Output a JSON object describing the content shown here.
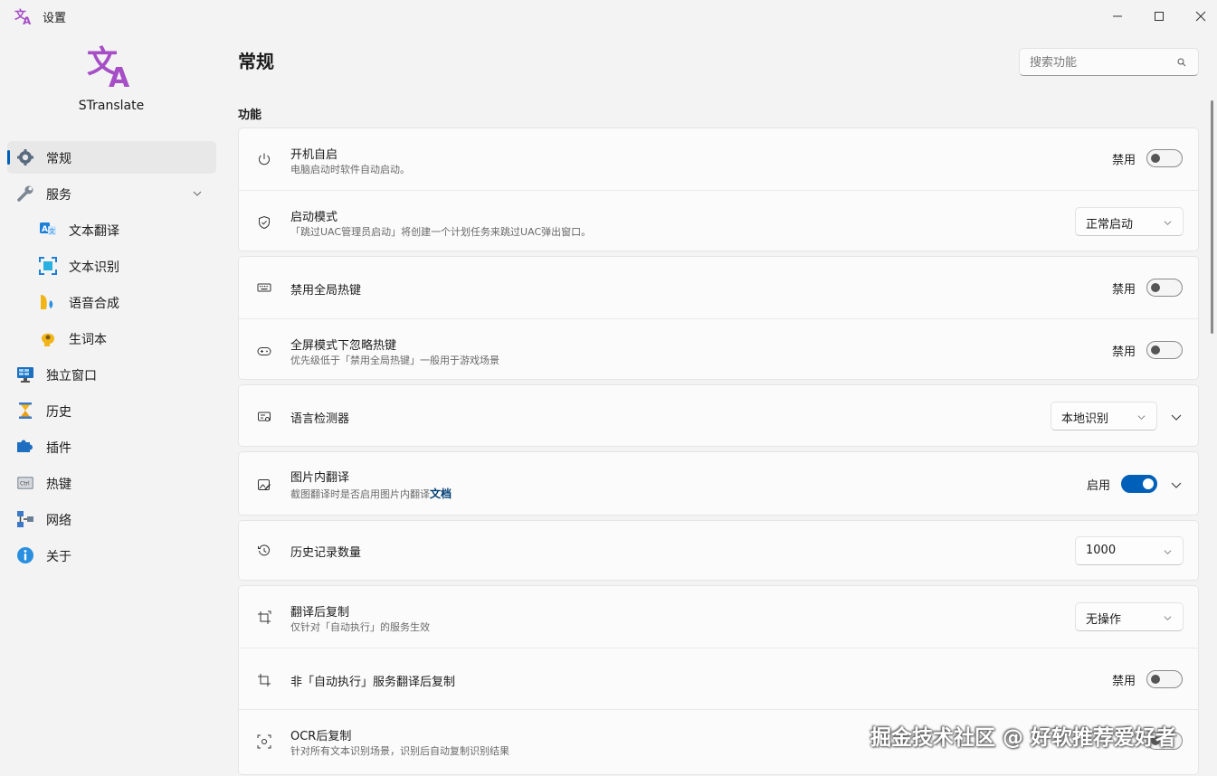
{
  "window": {
    "title": "设置"
  },
  "brand": {
    "name": "STranslate"
  },
  "sidebar": {
    "items": [
      {
        "label": "常规",
        "icon": "gear-icon"
      },
      {
        "label": "服务",
        "icon": "wrench-icon"
      },
      {
        "label": "文本翻译",
        "icon": "translate-icon"
      },
      {
        "label": "文本识别",
        "icon": "ocr-icon"
      },
      {
        "label": "语音合成",
        "icon": "speech-icon"
      },
      {
        "label": "生词本",
        "icon": "notebook-icon"
      },
      {
        "label": "独立窗口",
        "icon": "monitor-icon"
      },
      {
        "label": "历史",
        "icon": "hourglass-icon"
      },
      {
        "label": "插件",
        "icon": "plugin-icon"
      },
      {
        "label": "热键",
        "icon": "keyboard-ctrl-icon"
      },
      {
        "label": "网络",
        "icon": "network-icon"
      },
      {
        "label": "关于",
        "icon": "info-icon"
      }
    ]
  },
  "main": {
    "title": "常规",
    "search": {
      "placeholder": "搜索功能"
    },
    "section": "功能",
    "rows": {
      "autostart": {
        "title": "开机自启",
        "desc": "电脑启动时软件自动启动。",
        "state": "禁用"
      },
      "startmode": {
        "title": "启动模式",
        "desc": "「跳过UAC管理员启动」将创建一个计划任务来跳过UAC弹出窗口。",
        "value": "正常启动"
      },
      "disable_hotkeys": {
        "title": "禁用全局热键",
        "state": "禁用"
      },
      "fullscreen_ignore": {
        "title": "全屏模式下忽略热键",
        "desc": "优先级低于「禁用全局热键」一般用于游戏场景",
        "state": "禁用"
      },
      "lang_detector": {
        "title": "语言检测器",
        "value": "本地识别"
      },
      "image_translate": {
        "title": "图片内翻译",
        "desc": "截图翻译时是否启用图片内翻译",
        "link": "文档",
        "state": "启用"
      },
      "history_count": {
        "title": "历史记录数量",
        "value": "1000"
      },
      "copy_after": {
        "title": "翻译后复制",
        "desc": "仅针对「自动执行」的服务生效",
        "value": "无操作"
      },
      "copy_non_auto": {
        "title": "非「自动执行」服务翻译后复制",
        "state": "禁用"
      },
      "ocr_copy": {
        "title": "OCR后复制",
        "desc": "针对所有文本识别场景，识别后自动复制识别结果"
      }
    }
  },
  "watermark": "掘金技术社区 @ 好软推荐爱好者",
  "colors": {
    "accent": "#005fb8",
    "brand": "#a64ec6"
  }
}
